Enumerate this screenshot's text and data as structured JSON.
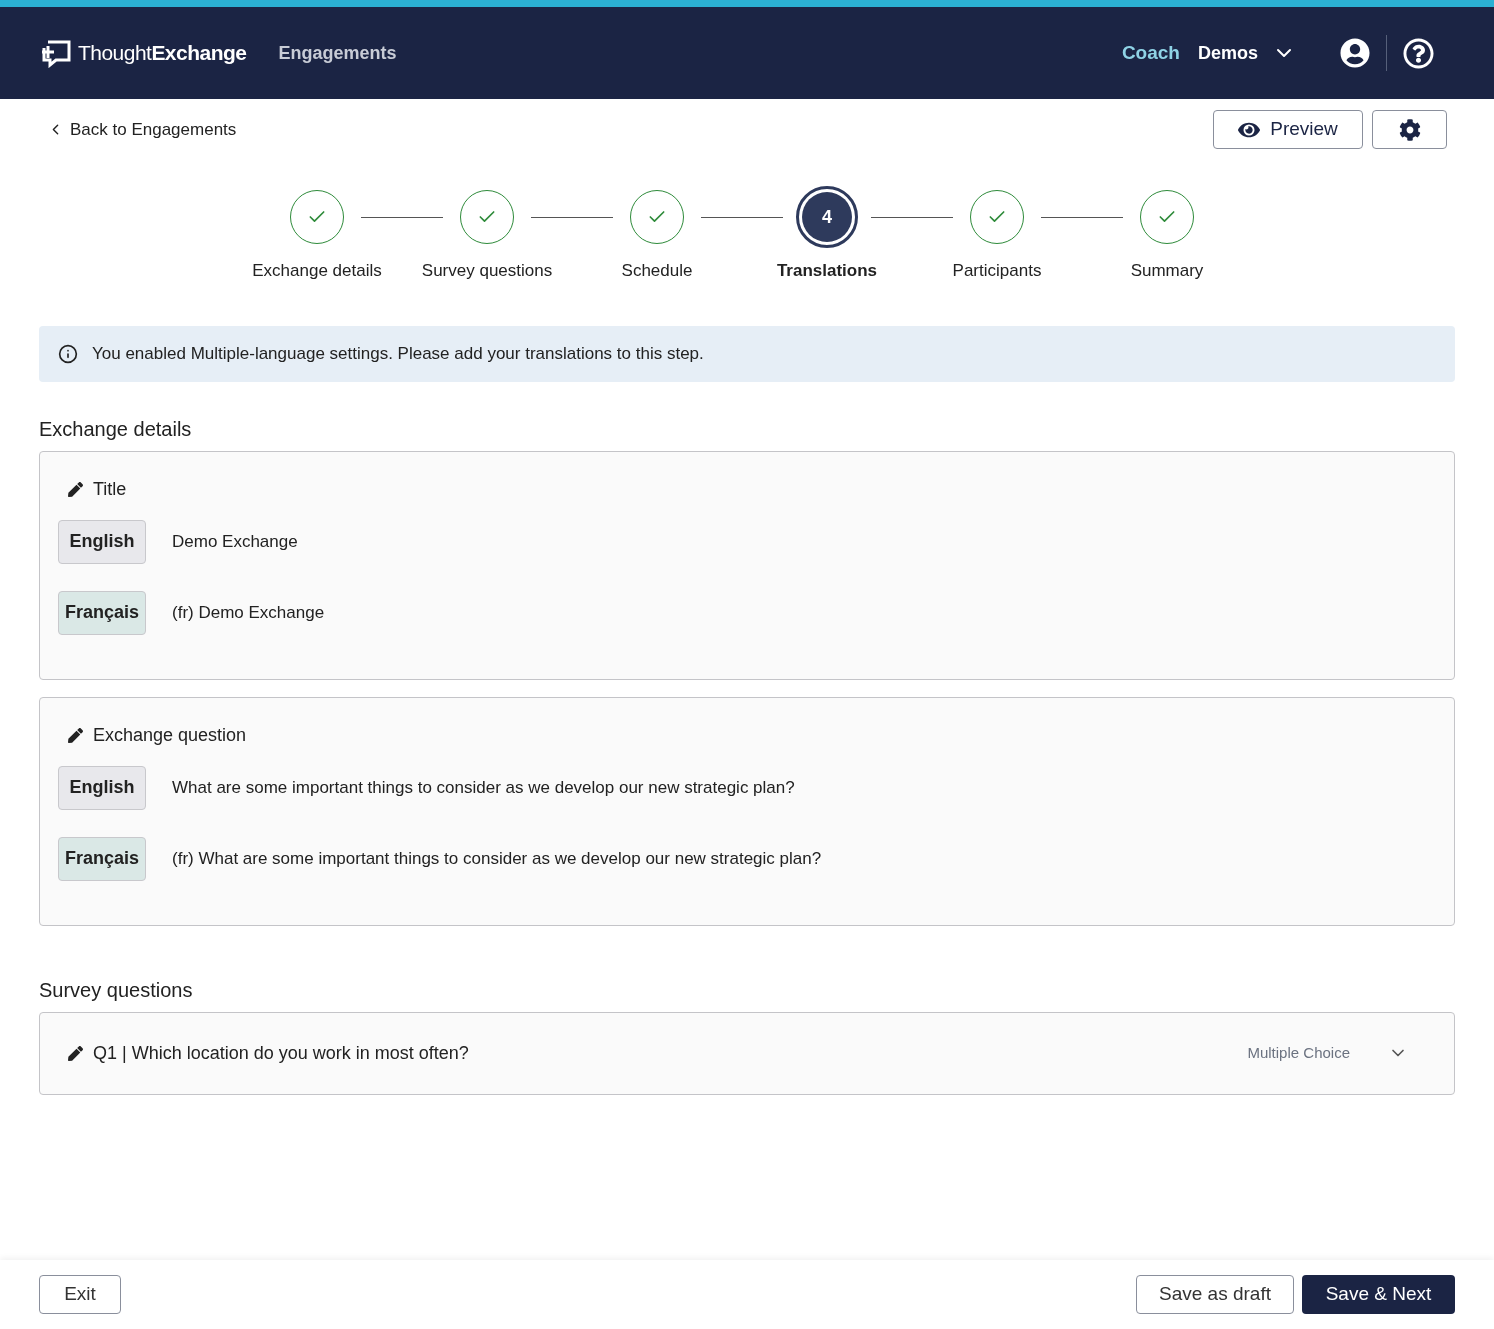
{
  "header": {
    "logo": "Thought**Exchange**",
    "nav": "Engagements",
    "coach": "Coach",
    "account": "Demos"
  },
  "back_link": "Back to Engagements",
  "preview_button": "Preview",
  "steps": [
    {
      "label": "Exchange details",
      "completed": true,
      "selected": false
    },
    {
      "label": "Survey questions",
      "completed": true,
      "selected": false
    },
    {
      "label": "Schedule",
      "completed": true,
      "selected": false
    },
    {
      "label": "Translations",
      "completed": false,
      "selected": true,
      "number": "4"
    },
    {
      "label": "Participants",
      "completed": true,
      "selected": false
    },
    {
      "label": "Summary",
      "completed": true,
      "selected": false
    }
  ],
  "notice": "You enabled Multiple-language settings. Please add your translations to this step.",
  "sections": [
    {
      "heading": "Exchange details",
      "cards": [
        {
          "title": "Title",
          "rows": [
            {
              "language": "English",
              "kind": "source",
              "text": "Demo Exchange"
            },
            {
              "language": "Français",
              "kind": "translation",
              "text": "(fr) Demo Exchange"
            }
          ]
        },
        {
          "title": "Exchange question",
          "rows": [
            {
              "language": "English",
              "kind": "source",
              "text": "What are some important things to consider as we develop our new strategic plan?"
            },
            {
              "language": "Français",
              "kind": "translation",
              "text": "(fr) What are some important things to consider as we develop our new strategic plan?"
            }
          ]
        }
      ]
    },
    {
      "heading": "Survey questions",
      "cards": [
        {
          "title": "Q1 | Which location do you work in most often?",
          "type": "Multiple Choice",
          "expanded": false
        }
      ]
    }
  ],
  "footer": {
    "exit": "Exit",
    "draft": "Save as draft",
    "next": "Save & Next"
  }
}
